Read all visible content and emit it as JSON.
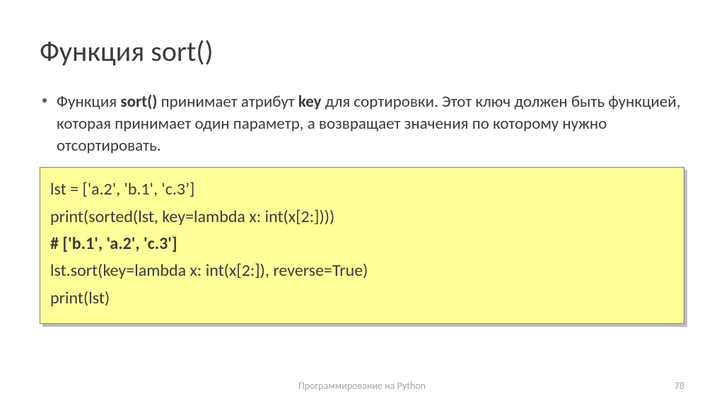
{
  "title": "Функция sort()",
  "bullet": {
    "pre": "Функция ",
    "b1": "sort()",
    "mid1": " принимает атрибут ",
    "b2": "key",
    "post": " для сортировки. Этот ключ должен быть функцией, которая принимает один параметр, а возвращает значения по которому нужно отсортировать."
  },
  "code": {
    "l1": "lst = ['a.2', 'b.1', 'c.3’]",
    "l2": "print(sorted(lst, key=lambda x: int(x[2:])))",
    "l3": "# ['b.1', 'a.2', 'c.3']",
    "l4": "lst.sort(key=lambda x: int(x[2:]), reverse=True)",
    "l5": "print(lst)"
  },
  "footer": "Программирование на Python",
  "page": "78"
}
